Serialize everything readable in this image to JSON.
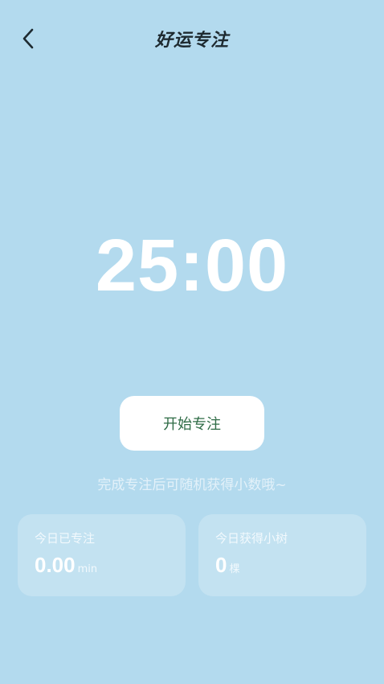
{
  "header": {
    "title": "好运专注",
    "back_icon": "chevron-left-icon"
  },
  "timer": {
    "display": "25:00"
  },
  "start_button": {
    "label": "开始专注"
  },
  "hint": "完成专注后可随机获得小数哦~",
  "stats": {
    "focused_today": {
      "label": "今日已专注",
      "value": "0.00",
      "unit": "min"
    },
    "trees_today": {
      "label": "今日获得小树",
      "value": "0",
      "unit": "棵"
    }
  },
  "colors": {
    "background": "#b3daee",
    "button_text": "#2e6b45",
    "white": "#ffffff"
  }
}
